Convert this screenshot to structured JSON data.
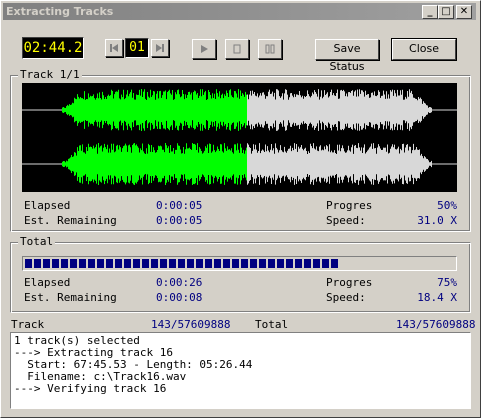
{
  "window": {
    "title": "Extracting Tracks"
  },
  "titlebar_buttons": {
    "minimize": "_",
    "maximize": "□",
    "close": "✕"
  },
  "toolbar": {
    "time": "02:44.2",
    "track_number": "01",
    "save_status_label": "Save Status",
    "close_label": "Close"
  },
  "track_group": {
    "label": "Track 1/1",
    "elapsed_label": "Elapsed",
    "elapsed_value": "0:00:05",
    "remaining_label": "Est. Remaining",
    "remaining_value": "0:00:05",
    "progress_label": "Progres",
    "progress_value": "50%",
    "progress_fraction": 0.5,
    "speed_label": "Speed:",
    "speed_value": "31.0 X"
  },
  "total_group": {
    "label": "Total",
    "elapsed_label": "Elapsed",
    "elapsed_value": "0:00:26",
    "remaining_label": "Est. Remaining",
    "remaining_value": "0:00:08",
    "progress_label": "Progres",
    "progress_value": "75%",
    "progress_fraction": 0.75,
    "speed_label": "Speed:",
    "speed_value": "18.4 X"
  },
  "status_row": {
    "track_label": "Track",
    "track_value": "143/57609888",
    "total_label": "Total",
    "total_value": "143/57609888"
  },
  "log": {
    "lines": [
      "1 track(s) selected",
      "---> Extracting track 16",
      "  Start: 67:45.53 - Length: 05:26.44",
      "  Filename: c:\\Track16.wav",
      "---> Verifying track 16"
    ]
  },
  "colors": {
    "wave_done": "#00ff00",
    "wave_pending": "#d8d8d8",
    "progress": "#000080",
    "lcd_text": "#ffff00"
  }
}
